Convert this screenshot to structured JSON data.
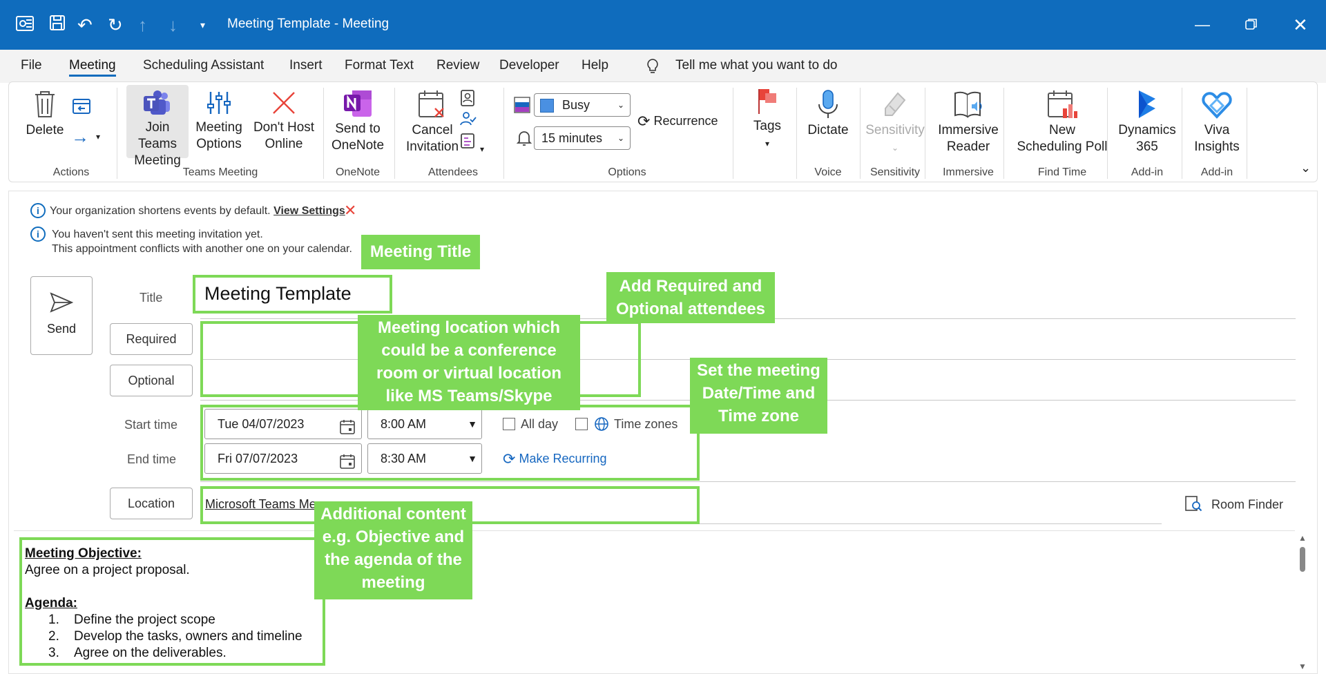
{
  "window": {
    "title": "Meeting Template  -  Meeting"
  },
  "menu": {
    "tabs": [
      "File",
      "Meeting",
      "Scheduling Assistant",
      "Insert",
      "Format Text",
      "Review",
      "Developer",
      "Help"
    ],
    "tell_me": "Tell me what you want to do"
  },
  "ribbon": {
    "actions": {
      "delete": "Delete",
      "group": "Actions"
    },
    "teams": {
      "join1": "Join Teams",
      "join2": "Meeting",
      "opt1": "Meeting",
      "opt2": "Options",
      "host1": "Don't Host",
      "host2": "Online",
      "group": "Teams Meeting"
    },
    "onenote": {
      "l1": "Send to",
      "l2": "OneNote",
      "group": "OneNote"
    },
    "attendees": {
      "l1": "Cancel",
      "l2": "Invitation",
      "group": "Attendees"
    },
    "options": {
      "show_as": "Busy",
      "reminder": "15 minutes",
      "recurrence": "Recurrence",
      "group": "Options"
    },
    "tags": {
      "label": "Tags"
    },
    "voice": {
      "label": "Dictate",
      "group": "Voice"
    },
    "sensitivity": {
      "label": "Sensitivity",
      "group": "Sensitivity"
    },
    "immersive": {
      "l1": "Immersive",
      "l2": "Reader",
      "group": "Immersive"
    },
    "findtime": {
      "l1": "New",
      "l2": "Scheduling Poll",
      "group": "Find Time"
    },
    "dynamics": {
      "l1": "Dynamics",
      "l2": "365",
      "group": "Add-in"
    },
    "viva": {
      "l1": "Viva",
      "l2": "Insights",
      "group": "Add-in"
    }
  },
  "info": {
    "line1": "Your organization shortens events by default.",
    "link": "View Settings",
    "line2": "You haven't sent this meeting invitation yet.",
    "line3": "This appointment conflicts with another one on your calendar."
  },
  "form": {
    "send": "Send",
    "title_label": "Title",
    "title_value": "Meeting Template",
    "required": "Required",
    "optional": "Optional",
    "start_label": "Start time",
    "end_label": "End time",
    "start_date": "Tue 04/07/2023",
    "start_time": "8:00 AM",
    "end_date": "Fri 07/07/2023",
    "end_time": "8:30 AM",
    "all_day": "All day",
    "time_zones": "Time zones",
    "make_recurring": "Make Recurring",
    "location_btn": "Location",
    "location_value": "Microsoft Teams Me",
    "room_finder": "Room Finder"
  },
  "body": {
    "objective_h": "Meeting Objective:",
    "objective": "Agree on a project proposal.",
    "agenda_h": "Agenda:",
    "items": [
      "Define the project scope",
      "Develop the tasks, owners and timeline",
      "Agree on the deliverables."
    ]
  },
  "callouts": {
    "title": "Meeting Title",
    "attendees1": "Add Required and",
    "attendees2": "Optional attendees",
    "location1": "Meeting location which",
    "location2": "could be a conference",
    "location3": "room or virtual location",
    "location4": "like MS Teams/Skype",
    "datetime1": "Set the meeting",
    "datetime2": "Date/Time and",
    "datetime3": "Time zone",
    "content1": "Additional content",
    "content2": "e.g. Objective and",
    "content3": "the agenda of the",
    "content4": "meeting"
  },
  "colors": {
    "titlebar": "#0f6cbd",
    "callout": "#7ed957"
  }
}
